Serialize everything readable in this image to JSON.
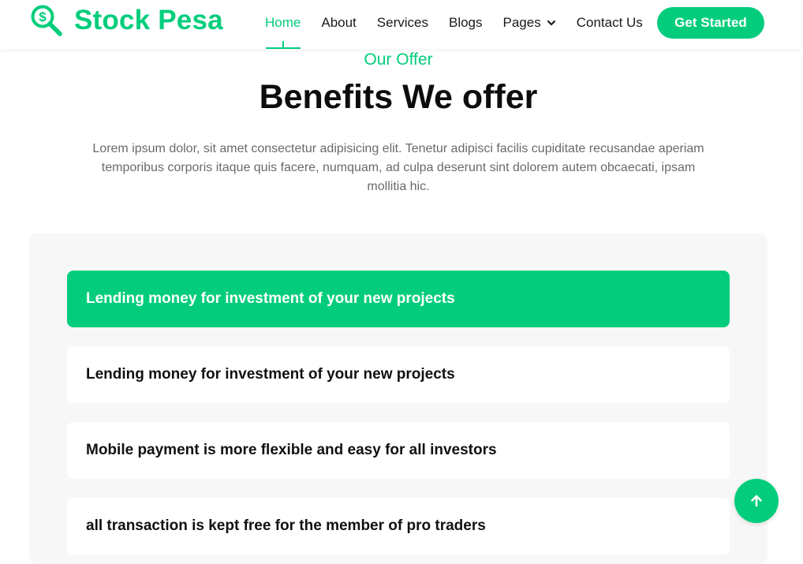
{
  "brand": {
    "name": "Stock Pesa",
    "icon": "dollar-search-icon"
  },
  "nav": {
    "items": [
      {
        "label": "Home",
        "active": true
      },
      {
        "label": "About"
      },
      {
        "label": "Services"
      },
      {
        "label": "Blogs"
      },
      {
        "label": "Pages",
        "has_dropdown": true
      },
      {
        "label": "Contact Us"
      }
    ],
    "cta_label": "Get Started"
  },
  "section": {
    "eyebrow": "Our Offer",
    "title": "Benefits We offer",
    "description": "Lorem ipsum dolor, sit amet consectetur adipisicing elit. Tenetur adipisci facilis cupiditate recusandae aperiam temporibus corporis itaque quis facere, numquam, ad culpa deserunt sint dolorem autem obcaecati, ipsam mollitia hic."
  },
  "benefits": [
    {
      "label": "Lending money for investment of your new projects",
      "active": true
    },
    {
      "label": "Lending money for investment of your new projects"
    },
    {
      "label": "Mobile payment is more flexible and easy for all investors"
    },
    {
      "label": "all transaction is kept free for the member of pro traders"
    }
  ],
  "colors": {
    "accent": "#03cd7c",
    "panel_bg": "#f7f7f7",
    "text": "#111111"
  },
  "scroll_top_icon": "arrow-up-icon"
}
